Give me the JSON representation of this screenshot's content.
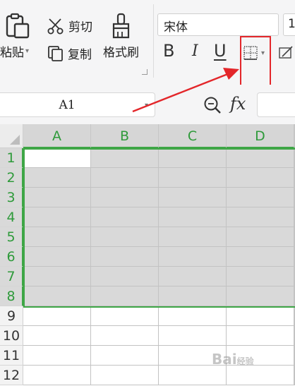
{
  "ribbon": {
    "paste_label": "粘贴",
    "cut_label": "剪切",
    "copy_label": "复制",
    "format_painter_label": "格式刷",
    "font_name": "宋体",
    "font_size": "1",
    "bold_label": "B",
    "italic_label": "I",
    "underline_label": "U"
  },
  "formula_bar": {
    "cell_ref": "A1",
    "fx_label": "fx"
  },
  "sheet": {
    "columns": [
      "A",
      "B",
      "C",
      "D"
    ],
    "rows": [
      "1",
      "2",
      "3",
      "4",
      "5",
      "6",
      "7",
      "8",
      "9",
      "10",
      "11",
      "12"
    ],
    "selected_rows": 8,
    "active_cell": "A1"
  },
  "watermark": {
    "text": "Bai",
    "sub": "经验"
  },
  "colors": {
    "selection": "#3ea646",
    "highlight": "#e3262a"
  }
}
